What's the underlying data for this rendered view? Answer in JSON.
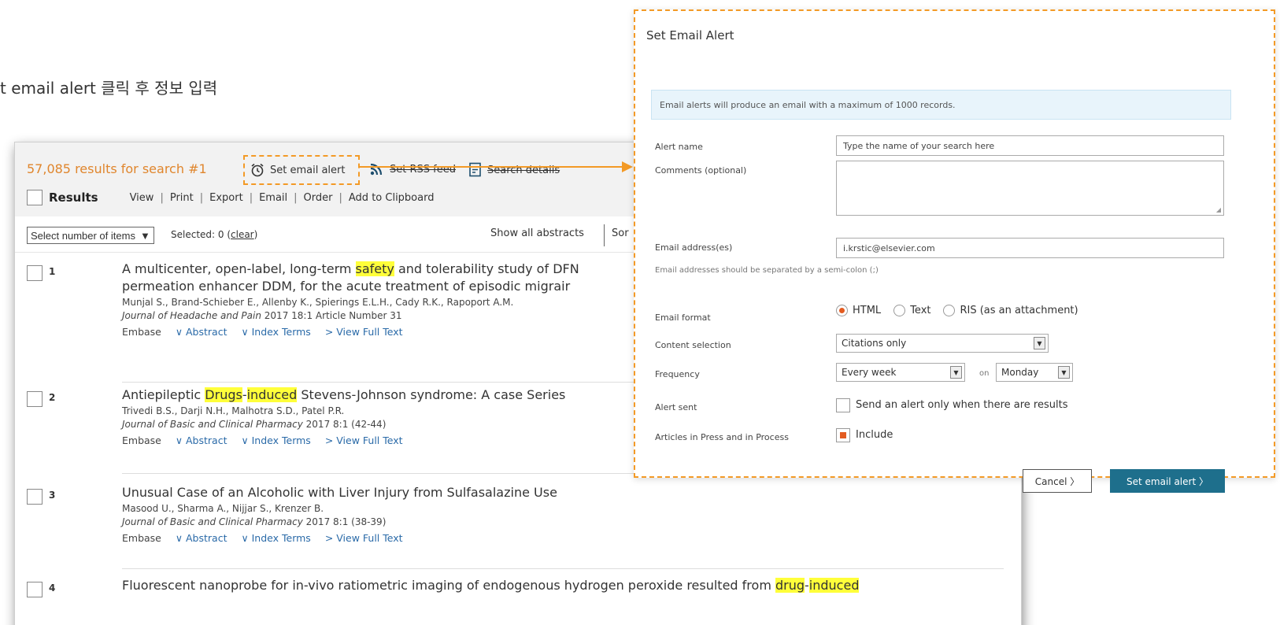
{
  "instruction": "t email alert 클릭 후 정보 입력",
  "results": {
    "count_text": "57,085 results for search #1",
    "tools": {
      "set_email_alert": "Set email alert",
      "set_rss_feed": "Set RSS feed",
      "search_details": "Search details"
    },
    "results_label": "Results",
    "menu": [
      "View",
      "Print",
      "Export",
      "Email",
      "Order",
      "Add to Clipboard"
    ],
    "select_items": "Select number of items",
    "selected_prefix": "Selected: 0 (",
    "clear": "clear",
    "selected_suffix": ")",
    "show_all_abstracts": "Show all abstracts",
    "sort_partial": "Sor",
    "items": [
      {
        "num": "1",
        "title_parts": [
          "A multicenter, open-label, long-term ",
          "safety",
          " and tolerability study of DFN",
          "permeation enhancer DDM, for the acute treatment of episodic migrair"
        ],
        "authors": "Munjal S., Brand-Schieber E., Allenby K., Spierings E.L.H., Cady R.K., Rapoport A.M.",
        "journal": "Journal of Headache and Pain",
        "journal_detail": " 2017 18:1 Article Number 31"
      },
      {
        "num": "2",
        "title_parts": [
          "Antiepileptic ",
          "Drugs",
          "-",
          "induced",
          " Stevens-Johnson syndrome: A case Series"
        ],
        "authors": "Trivedi B.S., Darji N.H., Malhotra S.D., Patel P.R.",
        "journal": "Journal of Basic and Clinical Pharmacy",
        "journal_detail": " 2017 8:1 (42-44)"
      },
      {
        "num": "3",
        "title": "Unusual Case of an Alcoholic with Liver Injury from Sulfasalazine Use",
        "authors": "Masood U., Sharma A., Nijjar S., Krenzer B.",
        "journal": "Journal of Basic and Clinical Pharmacy",
        "journal_detail": " 2017 8:1 (38-39)"
      },
      {
        "num": "4",
        "title_parts": [
          "Fluorescent nanoprobe for in-vivo ratiometric imaging of endogenous hydrogen peroxide resulted from ",
          "drug",
          "-",
          "induced"
        ]
      }
    ],
    "links": {
      "source": "Embase",
      "abstract": "∨ Abstract",
      "index_terms": "∨ Index Terms",
      "full_text": "> View Full Text"
    }
  },
  "dialog": {
    "title": "Set Email Alert",
    "info": "Email alerts will produce an email with a maximum of 1000 records.",
    "labels": {
      "alert_name": "Alert name",
      "comments": "Comments (optional)",
      "email": "Email address(es)",
      "email_format": "Email format",
      "content_selection": "Content selection",
      "frequency": "Frequency",
      "alert_sent": "Alert sent",
      "articles": "Articles in Press and in Process"
    },
    "alert_name_placeholder": "Type the name of your search here",
    "email_value": "i.krstic@elsevier.com",
    "email_hint": "Email addresses should be separated by a semi-colon (;)",
    "formats": [
      "HTML",
      "Text",
      "RIS (as an attachment)"
    ],
    "selected_format": "HTML",
    "content_selection_value": "Citations only",
    "frequency_value": "Every week",
    "on_label": "on",
    "day_value": "Monday",
    "alert_sent_label": "Send an alert only when there are results",
    "include_label": "Include",
    "cancel": "Cancel 〉",
    "submit": "Set email alert 〉"
  },
  "colors": {
    "accent_orange": "#f39a26",
    "count_orange": "#e0862d",
    "highlight": "#ffff3a",
    "link_blue": "#2a6aa8",
    "button_teal": "#1e6f8c",
    "radio_fill": "#e35b20"
  }
}
